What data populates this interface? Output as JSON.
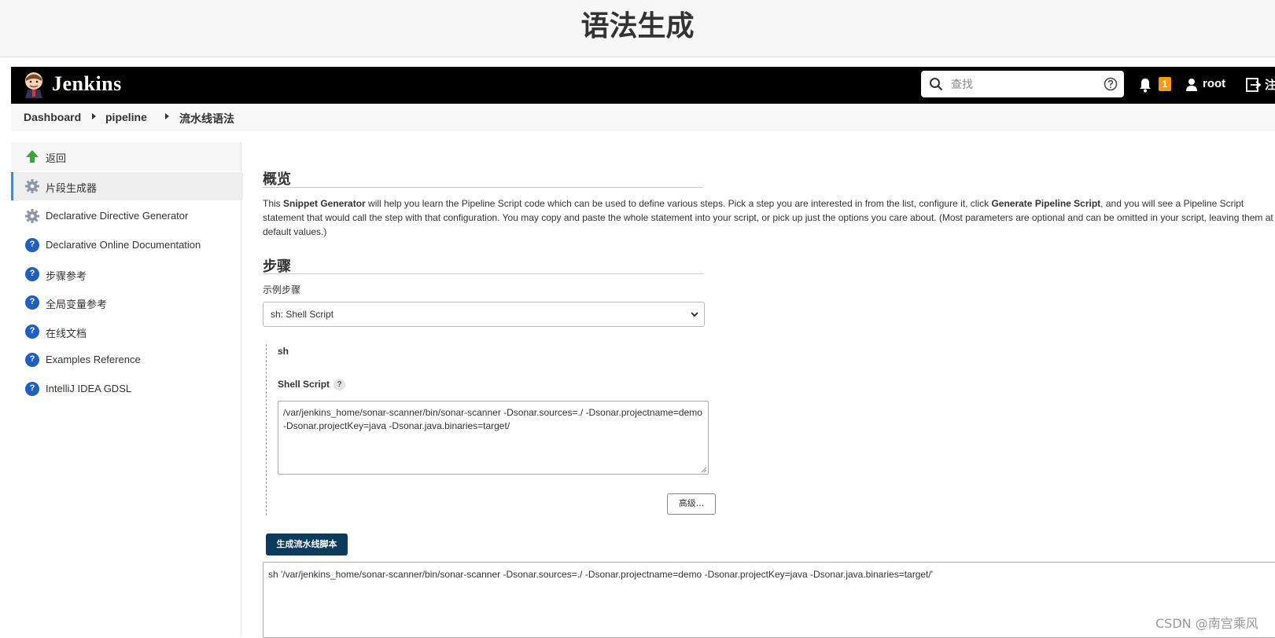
{
  "banner": {
    "title": "语法生成"
  },
  "header": {
    "brand": "Jenkins",
    "search": {
      "placeholder": "查找",
      "value": ""
    },
    "notifications": {
      "count": "1"
    },
    "user": "root",
    "logout_label": "注销"
  },
  "breadcrumb": {
    "items": [
      "Dashboard",
      "pipeline",
      "流水线语法"
    ]
  },
  "sidebar": {
    "items": [
      {
        "label": "返回",
        "icon": "up-arrow-icon"
      },
      {
        "label": "片段生成器",
        "icon": "gear-icon"
      },
      {
        "label": "Declarative Directive Generator",
        "icon": "gear-icon"
      },
      {
        "label": "Declarative Online Documentation",
        "icon": "help-icon"
      },
      {
        "label": "步骤参考",
        "icon": "help-icon"
      },
      {
        "label": "全局变量参考",
        "icon": "help-icon"
      },
      {
        "label": "在线文档",
        "icon": "help-icon"
      },
      {
        "label": "Examples Reference",
        "icon": "help-icon"
      },
      {
        "label": "IntelliJ IDEA GDSL",
        "icon": "help-icon"
      }
    ]
  },
  "overview": {
    "title": "概览",
    "text_1": "This ",
    "strong_1": "Snippet Generator",
    "text_2": " will help you learn the Pipeline Script code which can be used to define various steps. Pick a step you are interested in from the list, configure it, click ",
    "strong_2": "Generate Pipeline Script",
    "text_3": ", and you will see a Pipeline Script statement that would call the step with that configuration. You may copy and paste the whole statement into your script, or pick up just the options you care about. (Most parameters are optional and can be omitted in your script, leaving them at default values.)"
  },
  "steps": {
    "title": "步骤",
    "sample_label": "示例步骤",
    "selected": "sh: Shell Script",
    "step_name": "sh",
    "script_label": "Shell Script",
    "help_glyph": "?",
    "script_value": "/var/jenkins_home/sonar-scanner/bin/sonar-scanner -Dsonar.sources=./ -Dsonar.projectname=demo -Dsonar.projectKey=java -Dsonar.java.binaries=target/",
    "advanced_button": "高级...",
    "generate_button": "生成流水线脚本",
    "output": "sh '/var/jenkins_home/sonar-scanner/bin/sonar-scanner -Dsonar.sources=./ -Dsonar.projectname=demo -Dsonar.projectKey=java -Dsonar.java.binaries=target/'"
  },
  "watermark": "CSDN @南宫乘风",
  "colors": {
    "header_bg": "#000000",
    "accent": "#0b3c5d",
    "badge": "#f39c12",
    "help_icon": "#1f5fbf"
  }
}
